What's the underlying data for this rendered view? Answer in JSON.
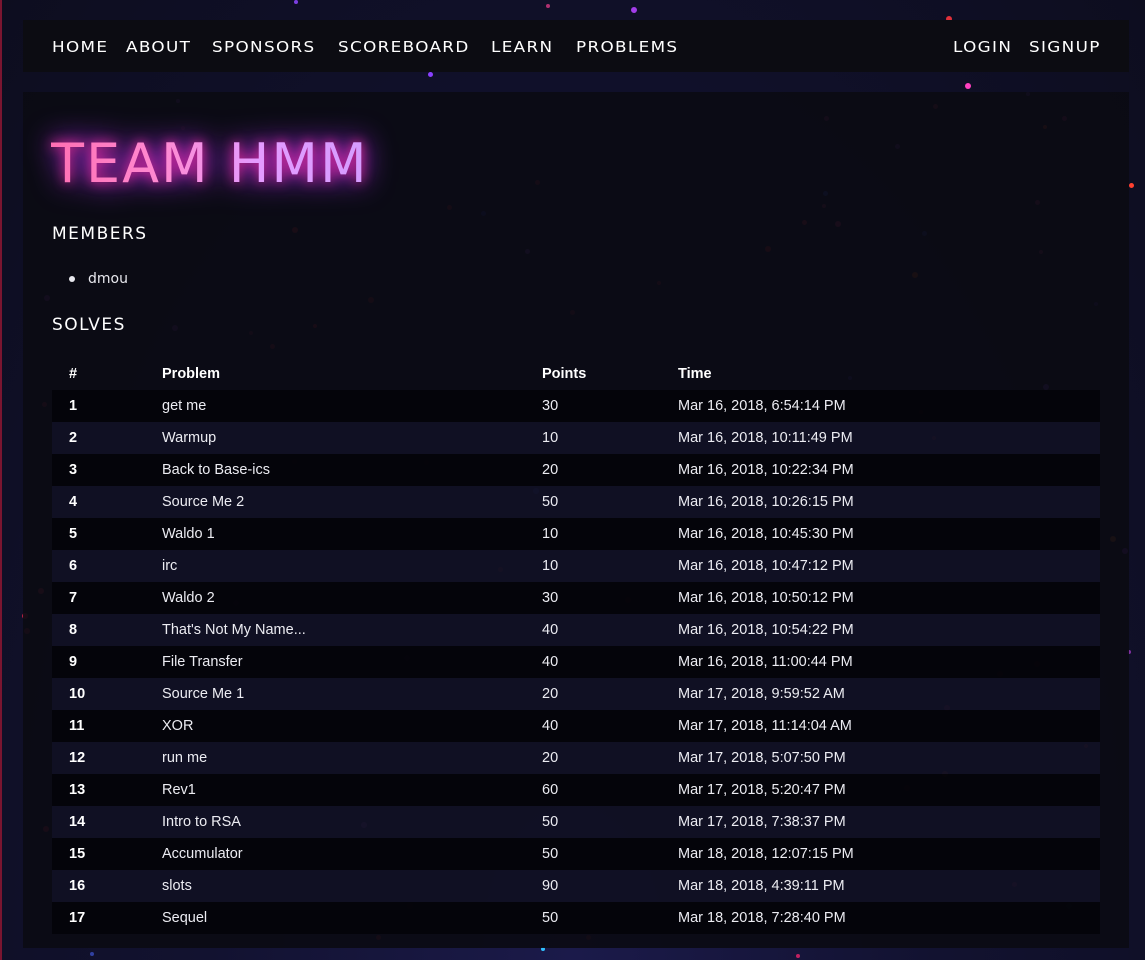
{
  "nav": {
    "left": [
      "HOME",
      "ABOUT",
      "SPONSORS",
      "SCOREBOARD",
      "LEARN",
      "PROBLEMS"
    ],
    "right": [
      "LOGIN",
      "SIGNUP"
    ]
  },
  "team": {
    "name": "TEAM HMM",
    "members_heading": "MEMBERS",
    "members": [
      "dmou"
    ],
    "solves_heading": "SOLVES"
  },
  "solves": {
    "headers": [
      "#",
      "Problem",
      "Points",
      "Time"
    ],
    "rows": [
      {
        "num": "1",
        "problem": "get me",
        "points": "30",
        "time": "Mar 16, 2018, 6:54:14 PM"
      },
      {
        "num": "2",
        "problem": "Warmup",
        "points": "10",
        "time": "Mar 16, 2018, 10:11:49 PM"
      },
      {
        "num": "3",
        "problem": "Back to Base-ics",
        "points": "20",
        "time": "Mar 16, 2018, 10:22:34 PM"
      },
      {
        "num": "4",
        "problem": "Source Me 2",
        "points": "50",
        "time": "Mar 16, 2018, 10:26:15 PM"
      },
      {
        "num": "5",
        "problem": "Waldo 1",
        "points": "10",
        "time": "Mar 16, 2018, 10:45:30 PM"
      },
      {
        "num": "6",
        "problem": "irc",
        "points": "10",
        "time": "Mar 16, 2018, 10:47:12 PM"
      },
      {
        "num": "7",
        "problem": "Waldo 2",
        "points": "30",
        "time": "Mar 16, 2018, 10:50:12 PM"
      },
      {
        "num": "8",
        "problem": "That's Not My Name...",
        "points": "40",
        "time": "Mar 16, 2018, 10:54:22 PM"
      },
      {
        "num": "9",
        "problem": "File Transfer",
        "points": "40",
        "time": "Mar 16, 2018, 11:00:44 PM"
      },
      {
        "num": "10",
        "problem": "Source Me 1",
        "points": "20",
        "time": "Mar 17, 2018, 9:59:52 AM"
      },
      {
        "num": "11",
        "problem": "XOR",
        "points": "40",
        "time": "Mar 17, 2018, 11:14:04 AM"
      },
      {
        "num": "12",
        "problem": "run me",
        "points": "20",
        "time": "Mar 17, 2018, 5:07:50 PM"
      },
      {
        "num": "13",
        "problem": "Rev1",
        "points": "60",
        "time": "Mar 17, 2018, 5:20:47 PM"
      },
      {
        "num": "14",
        "problem": "Intro to RSA",
        "points": "50",
        "time": "Mar 17, 2018, 7:38:37 PM"
      },
      {
        "num": "15",
        "problem": "Accumulator",
        "points": "50",
        "time": "Mar 18, 2018, 12:07:15 PM"
      },
      {
        "num": "16",
        "problem": "slots",
        "points": "90",
        "time": "Mar 18, 2018, 4:39:11 PM"
      },
      {
        "num": "17",
        "problem": "Sequel",
        "points": "50",
        "time": "Mar 18, 2018, 7:28:40 PM"
      }
    ]
  },
  "colors": {
    "background": "#121230",
    "navbar": "#0c0c12",
    "panel": "#0b0b13",
    "title_glow_pink": "#ff2fa0",
    "title_glow_purple": "#b02cff"
  }
}
